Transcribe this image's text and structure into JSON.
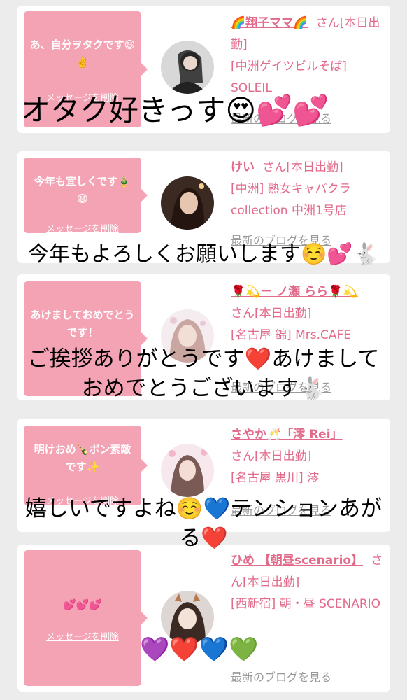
{
  "cards": [
    {
      "message": "あ、自分ヲタクです😆✌️",
      "delete_label": "メッセージを削除",
      "name": "🌈翔子ママ🌈",
      "honorific": "さん[本日出勤]",
      "shop": "[中洲ゲイツビルそば] SOLEIL",
      "blog_label": "最新のブログを見る"
    },
    {
      "message": "今年も宜しくです🎍😆",
      "delete_label": "メッセージを削除",
      "name": "けい",
      "honorific": "さん[本日出勤]",
      "shop": "[中洲] 熟女キャバクラcollection 中洲1号店",
      "blog_label": "最新のブログを見る"
    },
    {
      "message": "あけましておめでとうです！",
      "delete_label": "",
      "name": "🌹💫ー ノ瀬 らら🌹💫",
      "honorific": "さん[本日出勤]",
      "shop": "[名古屋 錦] Mrs.CAFE",
      "blog_label": "最新のブログを見る"
    },
    {
      "message": "明けおめ🍾ポン素敵です✨",
      "delete_label": "メッセージを削除",
      "name": "さやか🥂「澪 Rei」",
      "honorific": "さん[本日出勤]",
      "shop": "[名古屋 黒川] 澪",
      "blog_label": "最新のブログを見る"
    },
    {
      "message": "💕💕💕",
      "delete_label": "メッセージを削除",
      "name": "ひめ 【朝昼scenario】",
      "honorific": "さん[本日出勤]",
      "shop": "[西新宿] 朝・昼 SCENARIO",
      "blog_label": "最新のブログを見る"
    }
  ],
  "overlays": [
    "オタク好きっす😍💕💕",
    "今年もよろしくお願いします☺️💕🐇",
    "ご挨拶ありがとうです❤️あけまして",
    "おめでとうございます🐇",
    "嬉しいですよね☺️💙テンションあが",
    "る❤️",
    "💜❤️💙💚"
  ],
  "colors": {
    "accent": "#e26a8a",
    "bubble": "#f3a3b4"
  }
}
